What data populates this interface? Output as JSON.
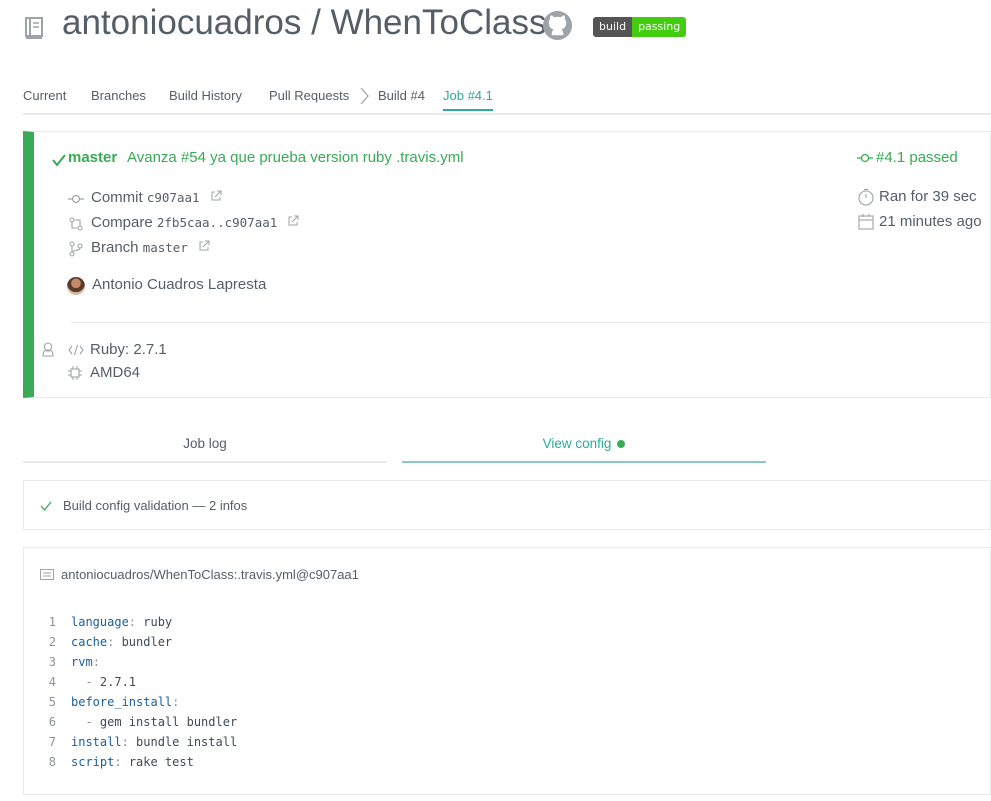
{
  "header": {
    "repo_owner": "antoniocuadros",
    "separator": "/",
    "repo_name": "WhenToClass",
    "badge_left": "build",
    "badge_right": "passing"
  },
  "tabs": [
    {
      "label": "Current"
    },
    {
      "label": "Branches"
    },
    {
      "label": "Build History"
    },
    {
      "label": "Pull Requests"
    },
    {
      "label": "Build #4"
    },
    {
      "label": "Job #4.1"
    }
  ],
  "job": {
    "branch": "master",
    "commit_message": "Avanza #54 ya que prueba version ruby .travis.yml",
    "status": "#4.1 passed",
    "commit_label": "Commit",
    "commit_sha": "c907aa1",
    "compare_label": "Compare",
    "compare_range": "2fb5caa..c907aa1",
    "branch_label": "Branch",
    "branch_value": "master",
    "author": "Antonio Cuadros Lapresta",
    "duration": "Ran for 39 sec",
    "finished": "21 minutes ago",
    "language": "Ruby: 2.7.1",
    "arch": "AMD64",
    "status_color": "#39aa56"
  },
  "sub_tabs": {
    "job_log": "Job log",
    "view_config": "View config"
  },
  "validation": {
    "text": "Build config validation — 2 infos"
  },
  "config": {
    "source": "antoniocuadros/WhenToClass:.travis.yml@c907aa1",
    "lines": [
      {
        "n": "1",
        "key": "language",
        "sep": ":",
        "val": " ruby"
      },
      {
        "n": "2",
        "key": "cache",
        "sep": ":",
        "val": " bundler"
      },
      {
        "n": "3",
        "key": "rvm",
        "sep": ":",
        "val": ""
      },
      {
        "n": "4",
        "dash": "  - ",
        "val": "2.7.1"
      },
      {
        "n": "5",
        "key": "before_install",
        "sep": ":",
        "val": ""
      },
      {
        "n": "6",
        "dash": "  - ",
        "val": "gem install bundler"
      },
      {
        "n": "7",
        "key": "install",
        "sep": ":",
        "val": " bundle install"
      },
      {
        "n": "8",
        "key": "script",
        "sep": ":",
        "val": " rake test"
      }
    ]
  }
}
